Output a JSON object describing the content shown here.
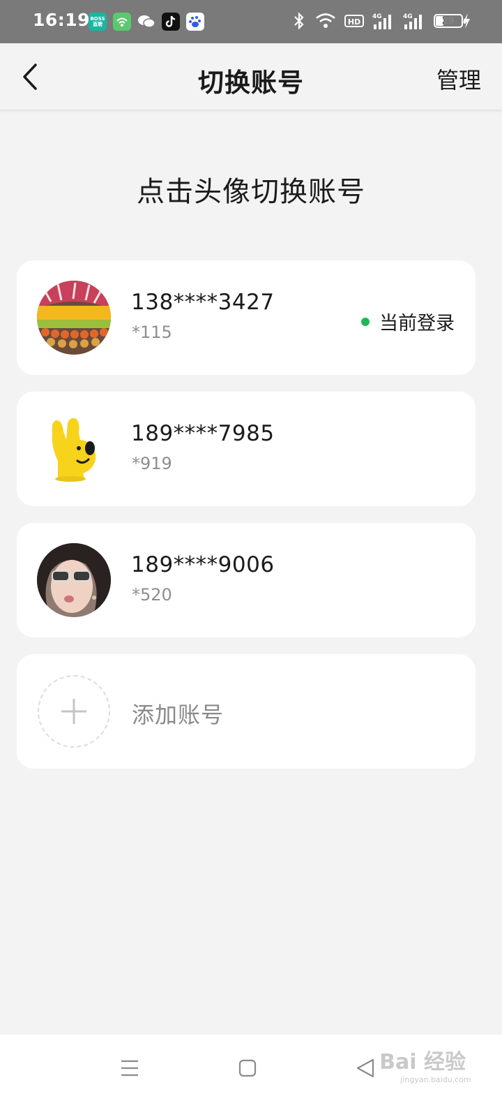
{
  "status_bar": {
    "time": "16:19",
    "app_icons": [
      "boss-zhipin-icon",
      "wifi-app-icon",
      "wechat-icon",
      "tiktok-icon",
      "baidu-icon"
    ],
    "boss_icon_text": "BOSS\n直聘",
    "battery_level": "29"
  },
  "header": {
    "title": "切换账号",
    "manage_label": "管理"
  },
  "prompt": "点击头像切换账号",
  "accounts": [
    {
      "phone": "138****3427",
      "sub": "*115",
      "status": "当前登录",
      "status_color": "#1fb954"
    },
    {
      "phone": "189****7985",
      "sub": "*919"
    },
    {
      "phone": "189****9006",
      "sub": "*520"
    }
  ],
  "add_account_label": "添加账号",
  "watermark": {
    "text": "Bai 经验",
    "url": "jingyan.baidu.com"
  },
  "colors": {
    "background": "#f3f3f3",
    "card": "#ffffff",
    "accent_green": "#1fb954",
    "status_bar": "#7a7a7a"
  }
}
